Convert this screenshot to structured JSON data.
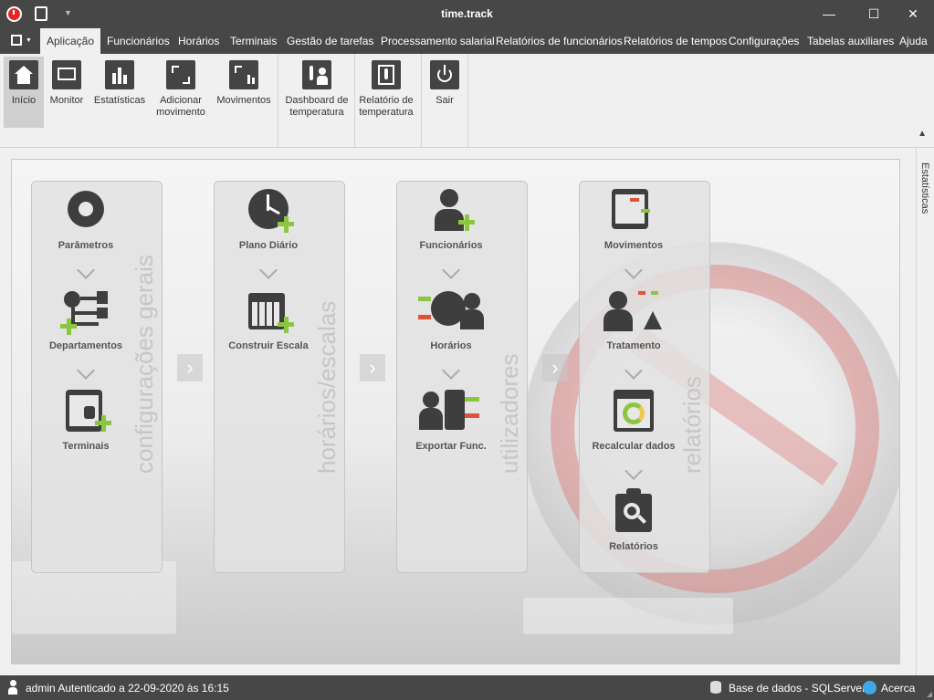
{
  "window": {
    "title": "time.track",
    "minimize_glyph": "—",
    "maximize_glyph": "☐",
    "close_glyph": "✕"
  },
  "menubar": {
    "items": [
      {
        "label": "Aplicação",
        "active": true
      },
      {
        "label": "Funcionários"
      },
      {
        "label": "Horários"
      },
      {
        "label": "Terminais"
      },
      {
        "label": "Gestão de tarefas"
      },
      {
        "label": "Processamento salarial"
      },
      {
        "label": "Relatórios de funcionários"
      },
      {
        "label": "Relatórios de tempos"
      },
      {
        "label": "Configurações"
      },
      {
        "label": "Tabelas auxiliares"
      },
      {
        "label": "Ajuda"
      }
    ]
  },
  "ribbon": {
    "buttons": [
      {
        "label": "Início",
        "icon": "home-icon",
        "selected": true
      },
      {
        "label": "Monitor",
        "icon": "monitor-icon"
      },
      {
        "label": "Estatísticas",
        "icon": "bar-chart-icon"
      },
      {
        "label": "Adicionar movimento",
        "icon": "add-movement-icon"
      },
      {
        "label": "Movimentos",
        "icon": "movements-icon"
      },
      {
        "label": "Dashboard de temperatura",
        "icon": "thermometer-person-icon"
      },
      {
        "label": "Relatório de temperatura",
        "icon": "temperature-report-icon"
      },
      {
        "label": "Sair",
        "icon": "power-icon"
      }
    ]
  },
  "panels": [
    {
      "title": "configurações gerais",
      "tiles": [
        {
          "label": "Parâmetros",
          "icon": "gear-icon"
        },
        {
          "label": "Departamentos",
          "icon": "org-chart-add-icon"
        },
        {
          "label": "Terminais",
          "icon": "terminal-add-icon"
        }
      ]
    },
    {
      "title": "horários/escalas",
      "tiles": [
        {
          "label": "Plano Diário",
          "icon": "clock-add-icon"
        },
        {
          "label": "Construir Escala",
          "icon": "calendar-add-icon"
        }
      ]
    },
    {
      "title": "utilizadores",
      "tiles": [
        {
          "label": "Funcionários",
          "icon": "user-add-icon"
        },
        {
          "label": "Horários",
          "icon": "clock-users-icon"
        },
        {
          "label": "Exportar Func.",
          "icon": "export-users-icon"
        }
      ]
    },
    {
      "title": "relatórios",
      "tiles": [
        {
          "label": "Movimentos",
          "icon": "terminal-movements-icon"
        },
        {
          "label": "Tratamento",
          "icon": "user-treatment-icon"
        },
        {
          "label": "Recalcular dados",
          "icon": "recalculate-icon"
        },
        {
          "label": "Relatórios",
          "icon": "report-search-icon"
        }
      ]
    }
  ],
  "sidepanel": {
    "label": "Estatísticas"
  },
  "statusbar": {
    "user_text": "admin Autenticado a 22-09-2020 às 16:15",
    "database_text": "Base de dados - SQLServer",
    "about_text": "Acerca"
  },
  "colors": {
    "chrome": "#474747",
    "accent_green": "#8cc63f",
    "accent_red": "#e0533b"
  }
}
